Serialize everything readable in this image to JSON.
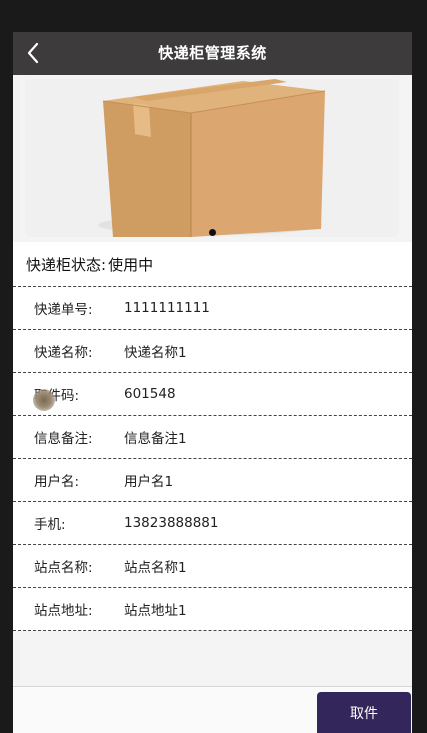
{
  "header": {
    "title": "快递柜管理系统",
    "back_icon": "chevron-left-icon"
  },
  "banner": {
    "image": "cardboard-box",
    "slides": 1,
    "active_slide": 1
  },
  "status": {
    "label": "快递柜状态:",
    "value": "使用中"
  },
  "details": [
    {
      "label": "快递单号:",
      "value": "1111111111"
    },
    {
      "label": "快递名称:",
      "value": "快递名称1"
    },
    {
      "label": "取件码:",
      "value": "601548"
    },
    {
      "label": "信息备注:",
      "value": "信息备注1"
    },
    {
      "label": "用户名:",
      "value": "用户名1"
    },
    {
      "label": "手机:",
      "value": "13823888881"
    },
    {
      "label": "站点名称:",
      "value": "站点名称1"
    },
    {
      "label": "站点地址:",
      "value": "站点地址1"
    }
  ],
  "actions": {
    "pickup_label": "取件"
  },
  "colors": {
    "header_bg": "#3d3b3c",
    "button_bg": "#33265a"
  }
}
